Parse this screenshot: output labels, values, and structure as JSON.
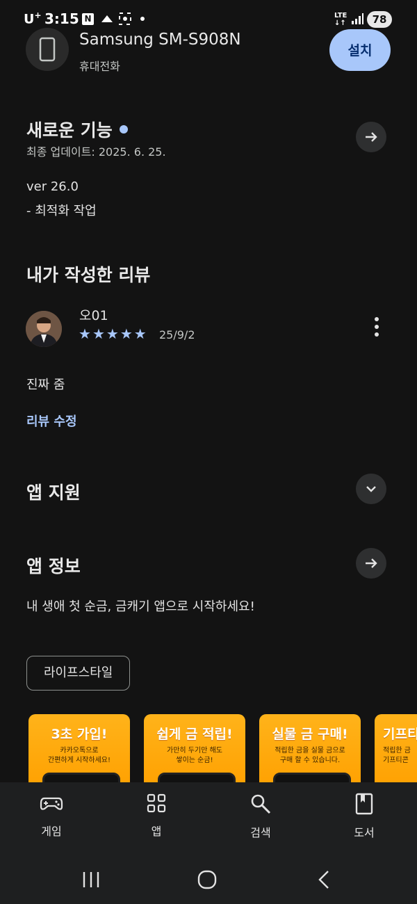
{
  "status_bar": {
    "carrier": "U",
    "carrier_sup": "+",
    "time": "3:15",
    "network": "LTE",
    "battery": "78"
  },
  "device": {
    "name": "Samsung SM-S908N",
    "type": "휴대전화",
    "install_label": "설치",
    "icon": "phone-icon"
  },
  "whats_new": {
    "title": "새로운 기능",
    "updated": "최종 업데이트: 2025. 6. 25.",
    "lines": [
      "ver 26.0",
      "- 최적화 작업"
    ]
  },
  "my_review": {
    "title": "내가 작성한 리뷰",
    "author": "오01",
    "rating": 5,
    "stars": "★★★★★",
    "date": "25/9/2",
    "text": "진짜 줌",
    "edit_label": "리뷰 수정"
  },
  "app_support": {
    "title": "앱 지원"
  },
  "app_info": {
    "title": "앱 정보",
    "description": "내 생애 첫 순금, 금캐기 앱으로 시작하세요!",
    "category": "라이프스타일"
  },
  "screenshots": [
    {
      "headline": "3초 가입!",
      "caption1": "카카오톡으로",
      "caption2": "간편하게 시작하세요!"
    },
    {
      "headline": "쉽게 금 적립!",
      "caption1": "가만히 두기만 해도",
      "caption2": "쌓이는 순금!"
    },
    {
      "headline": "실물 금 구매!",
      "caption1": "적립한 금을 실물 금으로",
      "caption2": "구매 할 수 있습니다."
    },
    {
      "headline": "기프티",
      "caption1": "적립한 금",
      "caption2": "기프티콘"
    }
  ],
  "bottom_nav": [
    {
      "label": "게임",
      "icon": "gamepad-icon"
    },
    {
      "label": "앱",
      "icon": "apps-grid-icon"
    },
    {
      "label": "검색",
      "icon": "search-icon"
    },
    {
      "label": "도서",
      "icon": "book-icon"
    }
  ],
  "colors": {
    "background": "#131313",
    "accent": "#a8c7fa",
    "install_text": "#062e6f"
  }
}
